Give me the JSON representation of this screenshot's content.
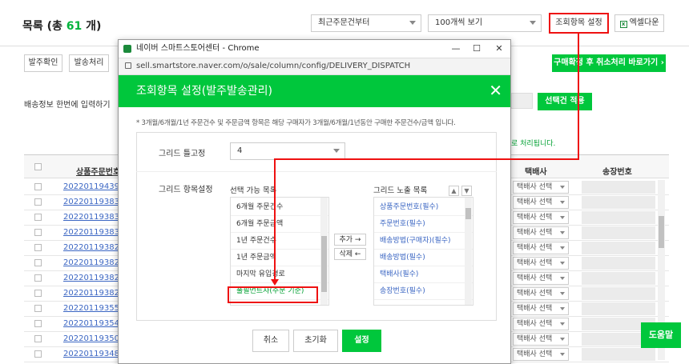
{
  "page": {
    "title_prefix": "목록 (총 ",
    "total_count": "61",
    "title_suffix": " 개)",
    "sort_select": "최근주문건부터",
    "page_size_select": "100개씩 보기",
    "column_config_button": "조회항목 설정",
    "excel_button": "엑셀다운",
    "action_buttons": [
      "발주확인",
      "발송처리"
    ],
    "cancel_after_button": "구매확정 후 취소처리 바로가기",
    "shipping_bulk_label": "배송정보 한번에 입력하기",
    "apply_selected_button": "선택건 적용",
    "processed_note": "로 처리됩니다.",
    "columns": {
      "order_no": "상품주문번호",
      "courier": "택배사",
      "tracking": "송장번호"
    },
    "rows": [
      {
        "order_no": "2022011943901",
        "courier": "택배사 선택"
      },
      {
        "order_no": "2022011938399",
        "courier": "택배사 선택"
      },
      {
        "order_no": "2022011938370",
        "courier": "택배사 선택"
      },
      {
        "order_no": "2022011938340",
        "courier": "택배사 선택"
      },
      {
        "order_no": "2022011938297",
        "courier": "택배사 선택"
      },
      {
        "order_no": "2022011938246",
        "courier": "택배사 선택"
      },
      {
        "order_no": "2022011938227",
        "courier": "택배사 선택"
      },
      {
        "order_no": "2022011938205",
        "courier": "택배사 선택"
      },
      {
        "order_no": "2022011935596",
        "courier": "택배사 선택"
      },
      {
        "order_no": "2022011935475",
        "courier": "택배사 선택"
      },
      {
        "order_no": "2022011935028",
        "courier": "택배사 선택"
      },
      {
        "order_no": "2022011934802",
        "courier": "택배사 선택"
      }
    ],
    "help_button": "도움말"
  },
  "popup": {
    "window_title": "네이버 스마트스토어센터 - Chrome",
    "url": "sell.smartstore.naver.com/o/sale/column/config/DELIVERY_DISPATCH",
    "header": "조회항목 설정(발주발송관리)",
    "notice": "* 3개월/6개월/1년 주문건수 및 주문금액 항목은 해당 구매자가 3개월/6개월/1년동안 구매한 주문건수/금액 입니다.",
    "grid_fix_label": "그리드 틀고정",
    "grid_fix_value": "4",
    "grid_items_label": "그리드 항목설정",
    "available_title": "선택 가능 목록",
    "visible_title": "그리드 노출 목록",
    "available_items": [
      "6개월 주문건수",
      "6개월 주문금액",
      "1년 주문건수",
      "1년 주문금액",
      "마지막 유입경로",
      "풀필먼트사(주문 기준)"
    ],
    "visible_items": [
      "상품주문번호(필수)",
      "주문번호(필수)",
      "배송방법(구매자)(필수)",
      "배송방법(필수)",
      "택배사(필수)",
      "송장번호(필수)"
    ],
    "add_button": "추가 →",
    "remove_button": "삭제 ←",
    "cancel_button": "취소",
    "reset_button": "초기화",
    "apply_button": "설정"
  },
  "colors": {
    "brand_green": "#00c73c",
    "annotation_red": "#e11111",
    "link_blue": "#3b66c3"
  }
}
